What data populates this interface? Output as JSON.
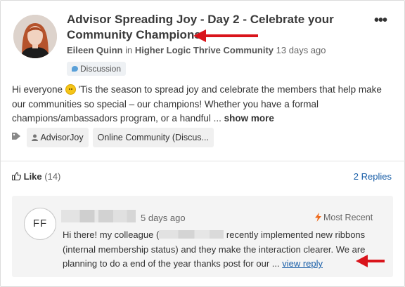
{
  "post": {
    "title": "Advisor Spreading Joy - Day 2 - Celebrate your Community Champions",
    "author": "Eileen Quinn",
    "in_text": "in",
    "community": "Higher Logic Thrive Community",
    "time_ago": "13 days ago",
    "badge": "Discussion",
    "body_before_emoji": "Hi everyone",
    "body_after_emoji": " 'Tis the season to spread joy and celebrate the members that help make our communities so special – our champions! Whether you have a formal champions/ambassadors program, or a handful ... ",
    "show_more": "show more",
    "tags": [
      "AdvisorJoy",
      "Online Community (Discus..."
    ]
  },
  "actions": {
    "like_label": "Like",
    "like_count": "(14)",
    "replies": "2 Replies"
  },
  "reply": {
    "initials": "FF",
    "time_ago": "5 days ago",
    "sort_label": "Most Recent",
    "text_before": "Hi there! my colleague (",
    "text_after": " recently implemented new ribbons (internal membership status) and they make the interaction clearer. We are planning to do a end of the year thanks post for our ... ",
    "view_reply": "view reply"
  },
  "colors": {
    "link": "#1a5fa8",
    "annotation_arrow": "#d9141b",
    "reply_bg": "#f4f4f4",
    "badge_bg": "#eef1f4"
  },
  "icons": [
    "more-options-icon",
    "speech-bubble-icon",
    "tag-icon",
    "person-icon",
    "thumbs-up-icon",
    "lightning-bolt-icon",
    "red-arrow-annotation"
  ]
}
